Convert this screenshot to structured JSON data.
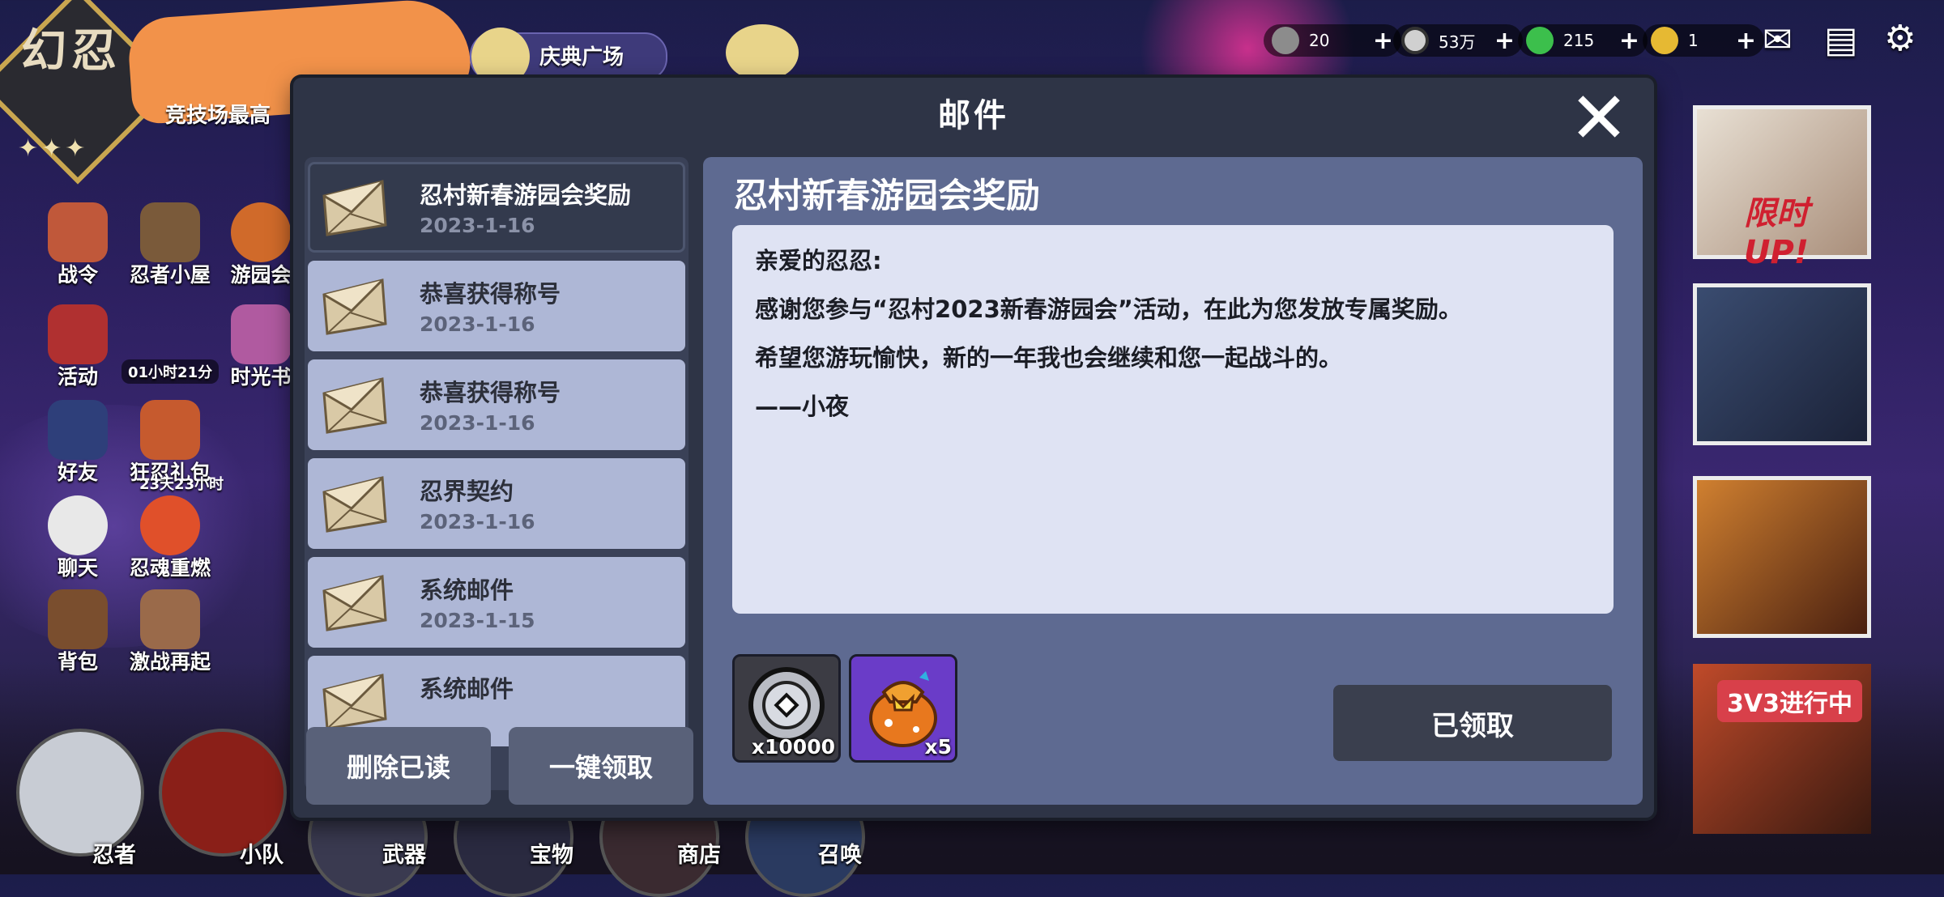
{
  "hud": {
    "logo_text": "幻忍",
    "logo_stars": "✦✦✦",
    "arena_label": "竞技场最高",
    "event_label": "庆典广场",
    "resources": [
      {
        "icon": "onigiri-icon",
        "value": "20"
      },
      {
        "icon": "coin-icon",
        "value": "53万"
      },
      {
        "icon": "pin-icon",
        "value": "215"
      },
      {
        "icon": "key-icon",
        "value": "1"
      }
    ],
    "side_left_col1": [
      "战令",
      "活动",
      "好友",
      "聊天",
      "背包"
    ],
    "side_left_col2": [
      "忍者小屋",
      "狂忍礼包",
      "忍魂重燃",
      "激战再起"
    ],
    "side_left_col3": [
      "游园会",
      "时光书"
    ],
    "timer_1": "01小时21分",
    "timer_2": "23天23小时",
    "right_banner_text": "限时UP!",
    "right_bottom_badge": "3V3进行中",
    "bottom_nav": [
      "忍者",
      "小队",
      "武器",
      "宝物",
      "商店",
      "召唤"
    ],
    "colors": {
      "accent_gold": "#c9a650",
      "redaction": "#f2924a"
    }
  },
  "modal": {
    "title": "邮件",
    "close_icon": "close-icon",
    "mail_items": [
      {
        "title": "忍村新春游园会奖励",
        "date": "2023-1-16",
        "selected": true
      },
      {
        "title": "恭喜获得称号",
        "date": "2023-1-16",
        "selected": false
      },
      {
        "title": "恭喜获得称号",
        "date": "2023-1-16",
        "selected": false
      },
      {
        "title": "忍界契约",
        "date": "2023-1-16",
        "selected": false
      },
      {
        "title": "系统邮件",
        "date": "2023-1-15",
        "selected": false
      },
      {
        "title": "系统邮件",
        "date": "",
        "selected": false
      }
    ],
    "delete_read_label": "删除已读",
    "claim_all_label": "一键领取",
    "detail": {
      "title": "忍村新春游园会奖励",
      "body_lines": [
        "亲爱的忍忍:",
        "感谢您参与“忍村2023新春游园会”活动，在此为您发放专属奖励。",
        "希望您游玩愉快，新的一年我也会继续和您一起战斗的。",
        "——小夜"
      ],
      "rewards": [
        {
          "icon": "silver-coin-icon",
          "qty": "x10000"
        },
        {
          "icon": "gift-bag-icon",
          "qty": "x5"
        }
      ],
      "claimed_label": "已领取"
    },
    "colors": {
      "modal_bg": "#2e3446",
      "item_bg": "#aeb7d6",
      "item_selected_bg": "#333a4d",
      "detail_bg": "#5e6a91",
      "body_bg": "#dfe3f3"
    }
  }
}
